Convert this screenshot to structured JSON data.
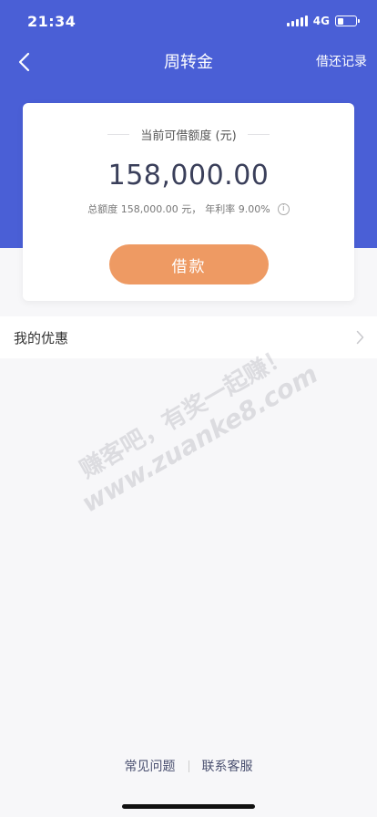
{
  "status_bar": {
    "time": "21:34",
    "network": "4G",
    "battery_level": 0.35
  },
  "nav": {
    "back_icon": "chevron-left-icon",
    "title": "周转金",
    "action_label": "借还记录"
  },
  "card": {
    "label": "当前可借额度 (元)",
    "amount": "158,000.00",
    "total_label": "总额度 158,000.00 元，",
    "rate_label": "年利率 9.00%",
    "info_icon": "info-icon",
    "borrow_button_label": "借款"
  },
  "coupon": {
    "label": "我的优惠",
    "chevron_icon": "chevron-right-icon"
  },
  "watermark": {
    "line1": "赚客吧，有奖一起赚！",
    "line2": "www.zuanke8.com"
  },
  "footer": {
    "faq_label": "常见问题",
    "contact_label": "联系客服"
  },
  "colors": {
    "header_blue": "#4a5fd6",
    "borrow_button": "#ee9a63",
    "amount_text": "#3a3f5a"
  }
}
